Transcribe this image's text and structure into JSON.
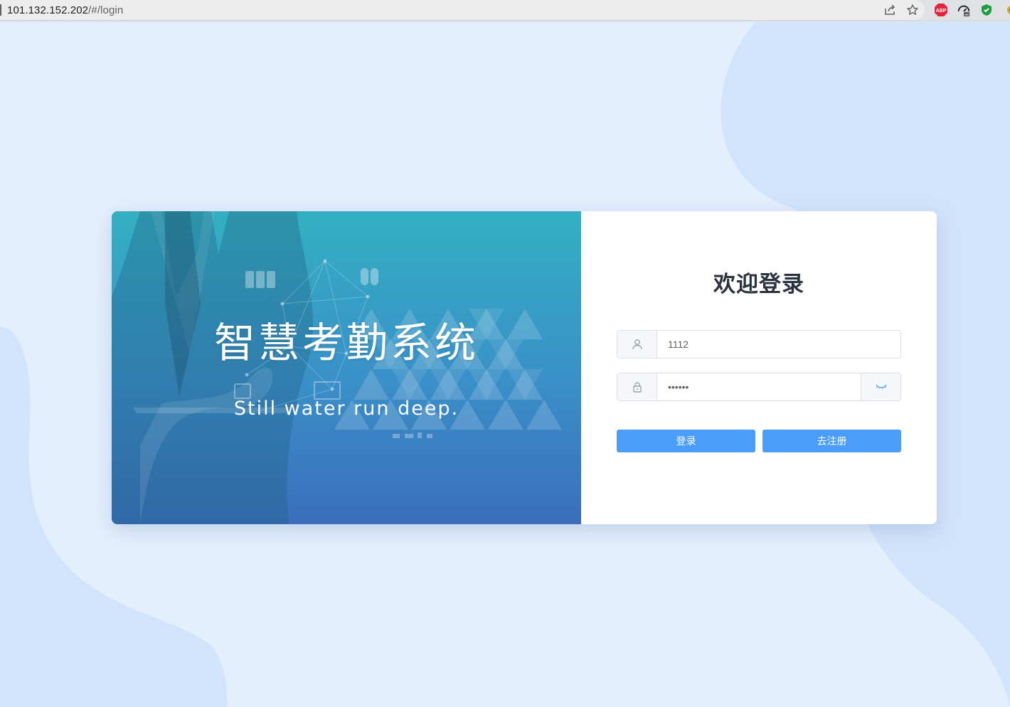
{
  "browser": {
    "url_host": "101.132.152.202",
    "url_path": "/#/login",
    "icons": [
      "share-icon",
      "bookmark-star-icon",
      "adblock-plus-icon",
      "speed-gauge-icon",
      "shield-check-icon",
      "extension-icon"
    ],
    "abp_label": "ABP"
  },
  "hero": {
    "title": "智慧考勤系统",
    "subtitle": "Still water run deep."
  },
  "login": {
    "title": "欢迎登录",
    "username_value": "1112",
    "password_value": "123456",
    "login_button": "登录",
    "register_button": "去注册"
  },
  "colors": {
    "page_bg": "#e4effd",
    "blob": "#d2e4fb",
    "primary_button": "#4a9df8",
    "hero_top": "#33b0c1",
    "hero_bottom": "#3b6ebc"
  }
}
